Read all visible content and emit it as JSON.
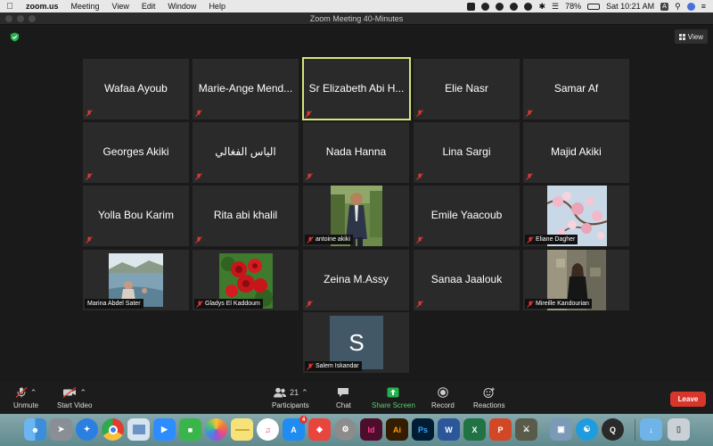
{
  "menubar": {
    "app": "zoom.us",
    "menus": [
      "Meeting",
      "View",
      "Edit",
      "Window",
      "Help"
    ],
    "battery": "78%",
    "input_source": "A",
    "datetime": "Sat 10:21 AM"
  },
  "window": {
    "title": "Zoom Meeting   40-Minutes"
  },
  "view_button": {
    "label": "View"
  },
  "participants": [
    {
      "name": "Wafaa Ayoub",
      "video": false
    },
    {
      "name": "Marie-Ange Mend...",
      "video": false
    },
    {
      "name": "Sr Elizabeth Abi H...",
      "video": false,
      "active_speaker": true
    },
    {
      "name": "Elie Nasr",
      "video": false
    },
    {
      "name": "Samar Af",
      "video": false
    },
    {
      "name": "Georges Akiki",
      "video": false
    },
    {
      "name": "الياس الفغالي",
      "video": false
    },
    {
      "name": "Nada Hanna",
      "video": false
    },
    {
      "name": "Lina Sargi",
      "video": false
    },
    {
      "name": "Majid Akiki",
      "video": false
    },
    {
      "name": "Yolla Bou Karim",
      "video": false
    },
    {
      "name": "Rita abi khalil",
      "video": false
    },
    {
      "name": "antoine akiki",
      "video": true
    },
    {
      "name": "Emile Yaacoub",
      "video": false
    },
    {
      "name": "Eliane Dagher",
      "video": true
    },
    {
      "name": "Marina Abdel Sater",
      "video": true
    },
    {
      "name": "Gladys El Kaddoum",
      "video": true
    },
    {
      "name": "Zeina M.Assy",
      "video": false
    },
    {
      "name": "Sanaa Jaalouk",
      "video": false
    },
    {
      "name": "Mireille Kandourian",
      "video": true
    },
    {
      "name": "Salem Iskandar",
      "video": true,
      "avatar_letter": "S"
    }
  ],
  "controls": {
    "unmute": "Unmute",
    "start_video": "Start Video",
    "participants": "Participants",
    "participants_count": "21",
    "chat": "Chat",
    "share_screen": "Share Screen",
    "record": "Record",
    "reactions": "Reactions",
    "leave": "Leave"
  },
  "dock": {
    "icons": [
      "finder-icon",
      "launchpad-icon",
      "safari-icon",
      "chrome-icon",
      "preview-icon",
      "zoom-icon",
      "facetime-icon",
      "photos-icon",
      "notes-icon",
      "itunes-icon",
      "app-store-icon",
      "anydesk-icon",
      "system-preferences-icon",
      "indesign-icon",
      "illustrator-icon",
      "photoshop-icon",
      "word-icon",
      "excel-icon",
      "powerpoint-icon",
      "game-icon",
      "photo-slideshow-icon",
      "accessibility-icon",
      "quicktime-icon",
      "downloads-folder-icon",
      "trash-icon"
    ],
    "app_store_badge": "4",
    "labels": {
      "indesign": "Id",
      "illustrator": "Ai",
      "photoshop": "Ps",
      "word": "W",
      "excel": "X",
      "powerpoint": "P"
    }
  },
  "colors": {
    "active_speaker_outline": "#d7e67c",
    "leave": "#d9362b",
    "share_screen": "#58d06b",
    "muted_icon": "#e0392f"
  }
}
